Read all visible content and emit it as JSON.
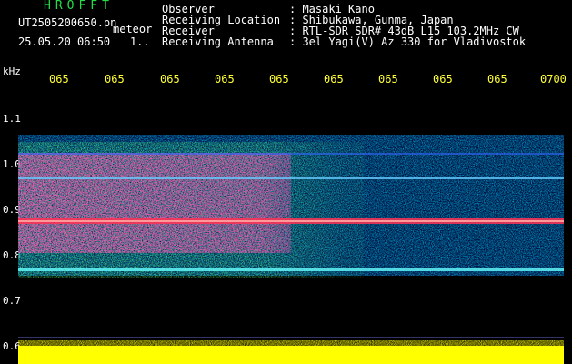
{
  "header": {
    "brand": "HROFFT",
    "filename": "UT2505200650.pn",
    "meteor_label": "meteor",
    "datetime": "25.05.20 06:50",
    "datetime_suffix": "1..",
    "info": [
      {
        "label": "Observer",
        "value": ": Masaki Kano"
      },
      {
        "label": "Receiving Location",
        "value": ": Shibukawa, Gunma, Japan"
      },
      {
        "label": "Receiver",
        "value": ": RTL-SDR SDR# 43dB L15 103.2MHz CW"
      },
      {
        "label": "Receiving Antenna",
        "value": ": 3el Yagi(V) Az 330 for Vladivostok"
      }
    ]
  },
  "axis": {
    "unit": "kHz",
    "y_ticks": [
      "1.1",
      "1.0",
      "0.9",
      "0.8",
      "0.7",
      "0.6"
    ],
    "x_ticks": [
      "065",
      "065",
      "065",
      "065",
      "065",
      "065",
      "065",
      "065",
      "065",
      "0700"
    ]
  },
  "colors": {
    "background": "#000000",
    "brand": "#22dd44",
    "tick_label": "#ffff33",
    "signal_band": "#ff3355",
    "floor": "#ffff00"
  }
}
